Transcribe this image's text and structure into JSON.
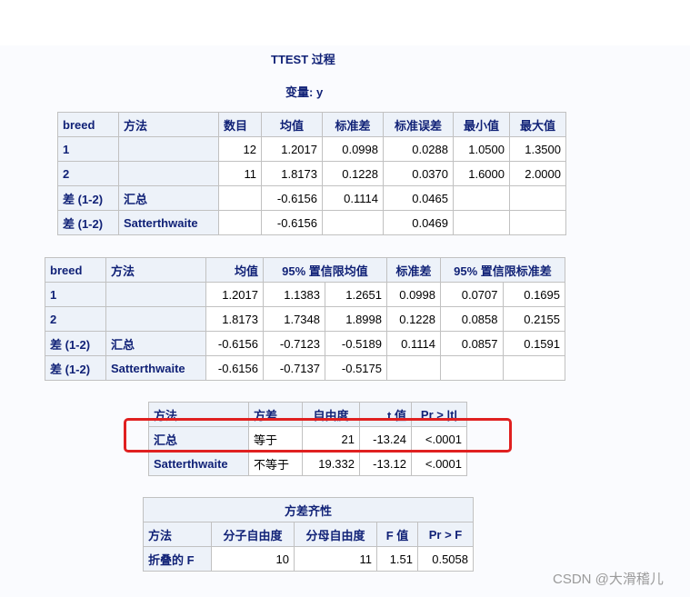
{
  "header": {
    "title": "TTEST 过程",
    "subtitle": "变量: y"
  },
  "table1": {
    "columns": [
      "breed",
      "方法",
      "数目",
      "均值",
      "标准差",
      "标准误差",
      "最小值",
      "最大值"
    ],
    "rows": [
      [
        "1",
        "",
        "12",
        "1.2017",
        "0.0998",
        "0.0288",
        "1.0500",
        "1.3500"
      ],
      [
        "2",
        "",
        "11",
        "1.8173",
        "0.1228",
        "0.0370",
        "1.6000",
        "2.0000"
      ],
      [
        "差 (1-2)",
        "汇总",
        "",
        "-0.6156",
        "0.1114",
        "0.0465",
        "",
        ""
      ],
      [
        "差 (1-2)",
        "Satterthwaite",
        "",
        "-0.6156",
        "",
        "0.0469",
        "",
        ""
      ]
    ]
  },
  "table2": {
    "columns": [
      "breed",
      "方法",
      "均值",
      "95% 置信限均值",
      "标准差",
      "95% 置信限标准差"
    ],
    "rows": [
      [
        "1",
        "",
        "1.2017",
        "1.1383",
        "1.2651",
        "0.0998",
        "0.0707",
        "0.1695"
      ],
      [
        "2",
        "",
        "1.8173",
        "1.7348",
        "1.8998",
        "0.1228",
        "0.0858",
        "0.2155"
      ],
      [
        "差 (1-2)",
        "汇总",
        "-0.6156",
        "-0.7123",
        "-0.5189",
        "0.1114",
        "0.0857",
        "0.1591"
      ],
      [
        "差 (1-2)",
        "Satterthwaite",
        "-0.6156",
        "-0.7137",
        "-0.5175",
        "",
        "",
        ""
      ]
    ]
  },
  "table3": {
    "columns": [
      "方法",
      "方差",
      "自由度",
      "t 值",
      "Pr > |t|"
    ],
    "rows": [
      [
        "汇总",
        "等于",
        "21",
        "-13.24",
        "<.0001"
      ],
      [
        "Satterthwaite",
        "不等于",
        "19.332",
        "-13.12",
        "<.0001"
      ]
    ]
  },
  "table4": {
    "title": "方差齐性",
    "columns": [
      "方法",
      "分子自由度",
      "分母自由度",
      "F 值",
      "Pr > F"
    ],
    "rows": [
      [
        "折叠的 F",
        "10",
        "11",
        "1.51",
        "0.5058"
      ]
    ]
  },
  "watermark": "CSDN @大滑稽儿",
  "colors": {
    "header_bg": "#edf2f9",
    "header_text": "#112277",
    "highlight": "#e02020"
  }
}
